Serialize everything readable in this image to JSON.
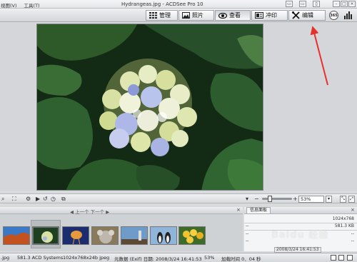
{
  "titlebar": {
    "menu": [
      "视图(V)",
      "工具(T)"
    ],
    "title": "Hydrangeas.jpg - ACDSee Pro 10"
  },
  "modes": [
    {
      "label": "管理",
      "icon": "grid-icon"
    },
    {
      "label": "照片",
      "icon": "photo-icon"
    },
    {
      "label": "查看",
      "icon": "eye-icon"
    },
    {
      "label": "冲印",
      "icon": "develop-icon"
    },
    {
      "label": "编辑",
      "icon": "edit-tools-icon"
    }
  ],
  "modebar_extra": {
    "round_icon_text": "365"
  },
  "toolbar": {
    "zoom_value": "53%"
  },
  "filmstrip": {
    "nav_prev": "上一个",
    "nav_next": "下一个",
    "thumbnails": [
      "Desert",
      "Hydrangeas",
      "Jellyfish",
      "Koala",
      "Lighthouse",
      "Penguins",
      "Tulips"
    ]
  },
  "info_panel": {
    "tab_label": "信息面板",
    "rows": [
      {
        "left": "",
        "right": "1024x768"
      },
      {
        "left": "--",
        "right": "581.3 KB"
      },
      {
        "left": "--",
        "right": "--"
      },
      {
        "left": "--",
        "right": "--"
      }
    ],
    "date": "2008/3/24  16:41:53"
  },
  "statusbar": {
    "ext": ".jpg",
    "size_owner": "581.3 ACD Systems",
    "dimensions": "1024x768x24b jpeg",
    "exif_date": "元数据 (Exif) 日期: 2008/3/24 16:41:53",
    "zoom": "53%",
    "load_time": "加载时间 0．04 秒"
  },
  "watermark": "Baidu 经验",
  "colors": {
    "annotation_arrow": "#e8302c"
  }
}
